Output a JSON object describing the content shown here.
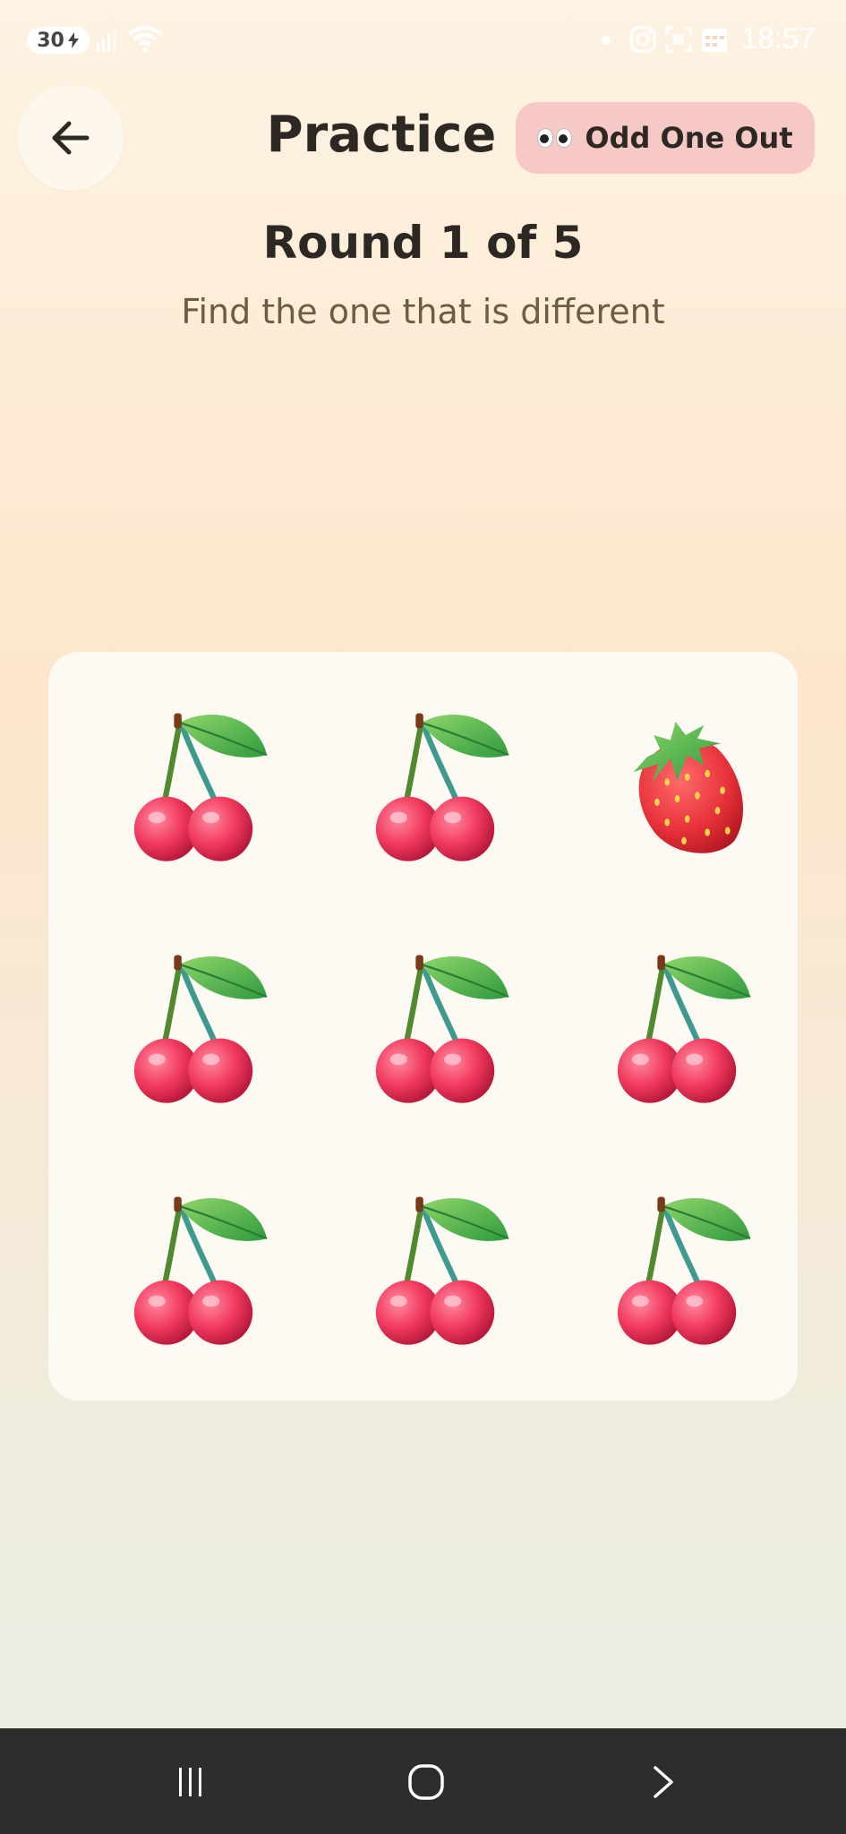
{
  "status_bar": {
    "battery": "30",
    "time": "18:57",
    "icons": [
      "charging-bolt-icon",
      "signal-icon",
      "wifi-icon",
      "notification-dot-icon",
      "instagram-icon",
      "scan-icon",
      "calendar-icon"
    ]
  },
  "header": {
    "back_icon": "arrow-left-icon",
    "title": "Practice",
    "mode_chip": {
      "icon": "eyes-icon",
      "label": "Odd One Out",
      "color": "#f6c8c6"
    }
  },
  "game": {
    "round_label": "Round 1 of 5",
    "instruction": "Find the one that is different",
    "tiles": [
      {
        "item": "cherries"
      },
      {
        "item": "cherries"
      },
      {
        "item": "strawberry"
      },
      {
        "item": "cherries"
      },
      {
        "item": "cherries"
      },
      {
        "item": "cherries"
      },
      {
        "item": "cherries"
      },
      {
        "item": "cherries"
      },
      {
        "item": "cherries"
      }
    ]
  },
  "nav_bar": {
    "buttons": [
      "recent-apps-icon",
      "home-icon",
      "back-chevron-icon"
    ]
  }
}
